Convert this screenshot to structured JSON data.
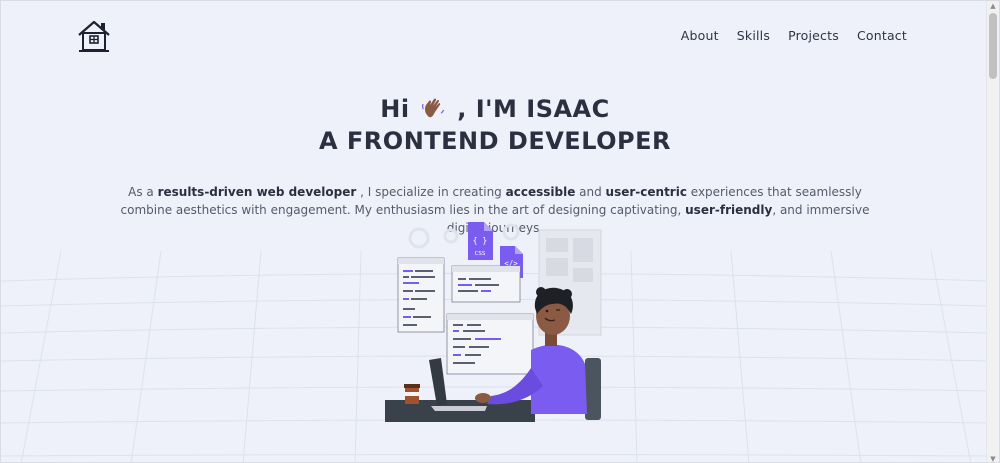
{
  "nav": {
    "items": [
      "About",
      "Skills",
      "Projects",
      "Contact"
    ]
  },
  "hero": {
    "greeting_before": "Hi",
    "greeting_after": ", I'M ISAAC",
    "role_line": "A FRONTEND DEVELOPER",
    "intro": {
      "p1": "As a ",
      "b1": "results-driven web developer",
      "p2": " , I specialize in creating ",
      "b2": "accessible",
      "p3": " and ",
      "b3": "user-centric",
      "p4": " experiences that seamlessly combine aesthetics with engagement. My enthusiasm lies in the art of designing captivating, ",
      "b4": "user-friendly",
      "p5": ", and immersive digital journeys."
    }
  },
  "illustration": {
    "css_badge": "CSS",
    "brace_badge": "{ }",
    "html_badge": "</>"
  },
  "colors": {
    "background": "#eef1f9",
    "text_dark": "#2b2f40",
    "text_muted": "#555a6b",
    "accent_purple": "#7b5cf0"
  }
}
